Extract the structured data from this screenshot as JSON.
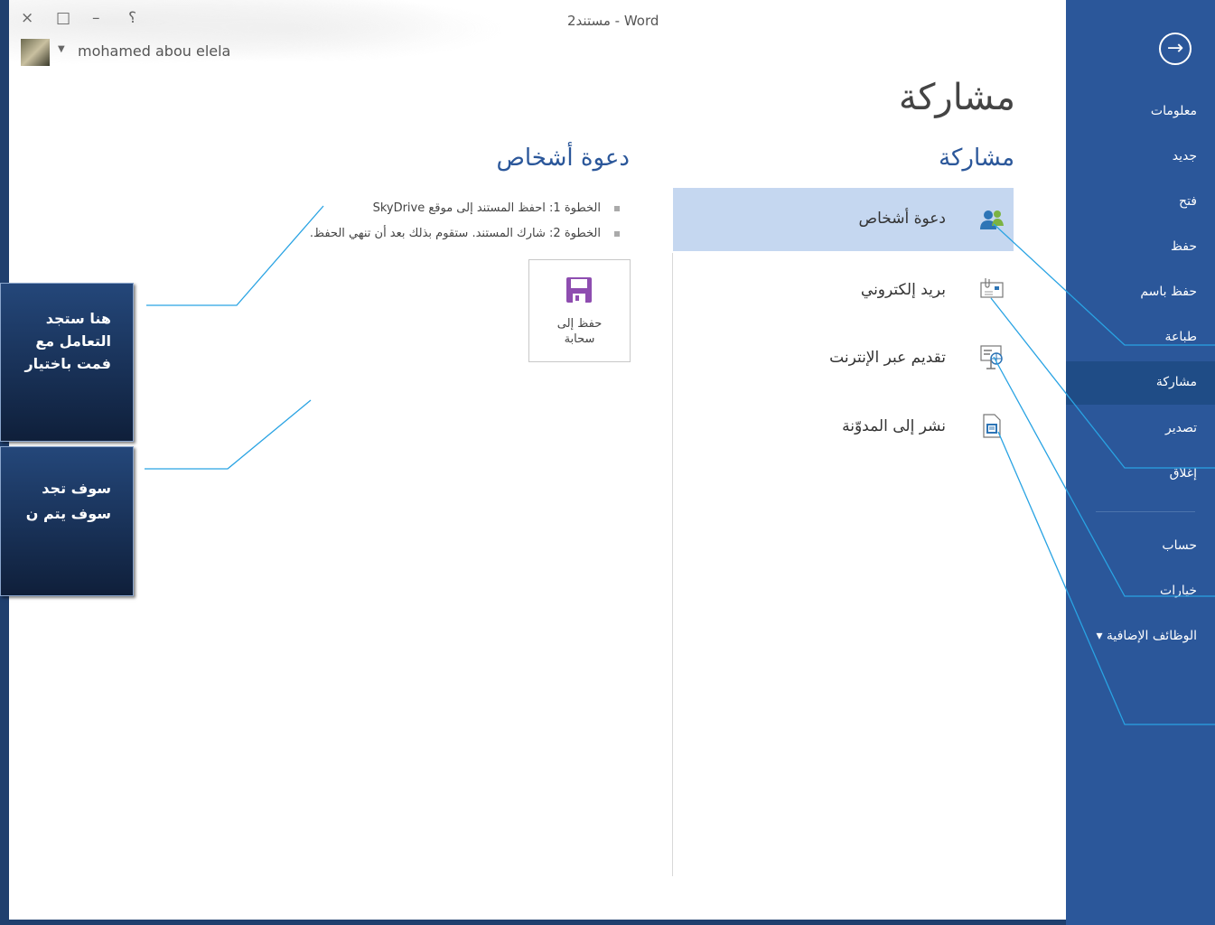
{
  "window": {
    "title": "مستند2 - Word",
    "controls": {
      "help": "؟",
      "minimize": "–",
      "restore": "□",
      "close": "×"
    },
    "user": {
      "name": "mohamed abou elela"
    }
  },
  "sidebar": {
    "back_icon": "arrow-right-circle-icon",
    "items": [
      {
        "label": "معلومات"
      },
      {
        "label": "جديد"
      },
      {
        "label": "فتح"
      },
      {
        "label": "حفظ"
      },
      {
        "label": "حفظ باسم"
      },
      {
        "label": "طباعة"
      },
      {
        "label": "مشاركة",
        "active": true
      },
      {
        "label": "تصدير"
      },
      {
        "label": "إغلاق"
      },
      {
        "label": "حساب"
      },
      {
        "label": "خيارات"
      },
      {
        "label": "الوظائف الإضافية ▾"
      }
    ],
    "colors": {
      "background": "#2b579a",
      "active": "#1f4c86"
    }
  },
  "main": {
    "page_title": "مشاركة",
    "section_title": "مشاركة",
    "share_options": [
      {
        "label": "دعوة أشخاص",
        "icon": "people-icon",
        "selected": true
      },
      {
        "label": "بريد إلكتروني",
        "icon": "email-attachment-icon"
      },
      {
        "label": "تقديم عبر الإنترنت",
        "icon": "online-presentation-icon"
      },
      {
        "label": "نشر إلى المدوّنة",
        "icon": "blog-post-icon"
      }
    ],
    "invite": {
      "title": "دعوة أشخاص",
      "steps": [
        "الخطوة 1: احفظ المستند إلى موقع SkyDrive",
        "الخطوة 2: شارك المستند. ستقوم بذلك بعد أن تنهي الحفظ."
      ],
      "save_to_cloud": {
        "line1": "حفظ إلى",
        "line2": "سحابة",
        "icon": "floppy-disk-icon"
      }
    }
  },
  "callouts": [
    {
      "lines": [
        "هنا ستجد",
        "التعامل مع",
        "فمت باختيار"
      ]
    },
    {
      "lines": [
        "سوف تجد",
        "سوف يتم ن"
      ]
    }
  ]
}
